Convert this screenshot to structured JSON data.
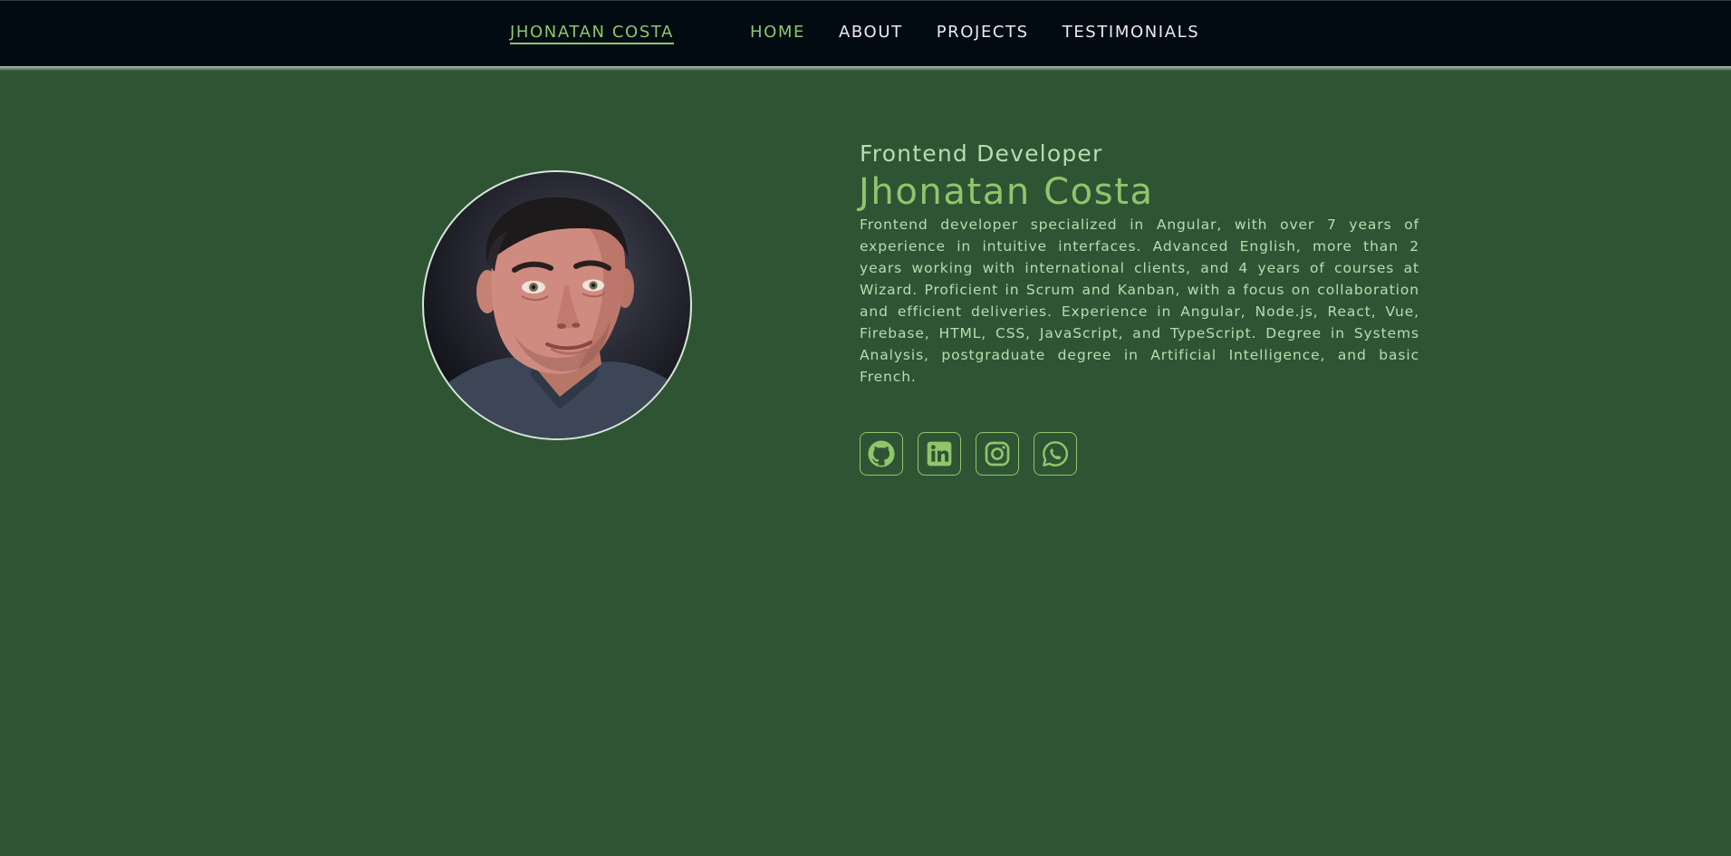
{
  "nav": {
    "brand": "JHONATAN COSTA",
    "links": [
      {
        "label": "HOME",
        "active": true
      },
      {
        "label": "ABOUT",
        "active": false
      },
      {
        "label": "PROJECTS",
        "active": false
      },
      {
        "label": "TESTIMONIALS",
        "active": false
      }
    ]
  },
  "hero": {
    "subtitle": "Frontend Developer",
    "name": "Jhonatan Costa",
    "bio": "Frontend developer specialized in Angular, with over 7 years of experience in intuitive interfaces. Advanced English, more than 2 years working with international clients, and 4 years of courses at Wizard. Proficient in Scrum and Kanban, with a focus on collaboration and efficient deliveries. Experience in Angular, Node.js, React, Vue, Firebase, HTML, CSS, JavaScript, and TypeScript. Degree in Systems Analysis, postgraduate degree in Artificial Intelligence, and basic French."
  },
  "socials": [
    {
      "icon": "github-icon"
    },
    {
      "icon": "linkedin-icon"
    },
    {
      "icon": "instagram-icon"
    },
    {
      "icon": "whatsapp-icon"
    }
  ],
  "colors": {
    "background": "#2f5434",
    "navbar": "#020b12",
    "accent": "#8fc66b",
    "text_light": "#b9dcae",
    "nav_text": "#e8ecef"
  }
}
